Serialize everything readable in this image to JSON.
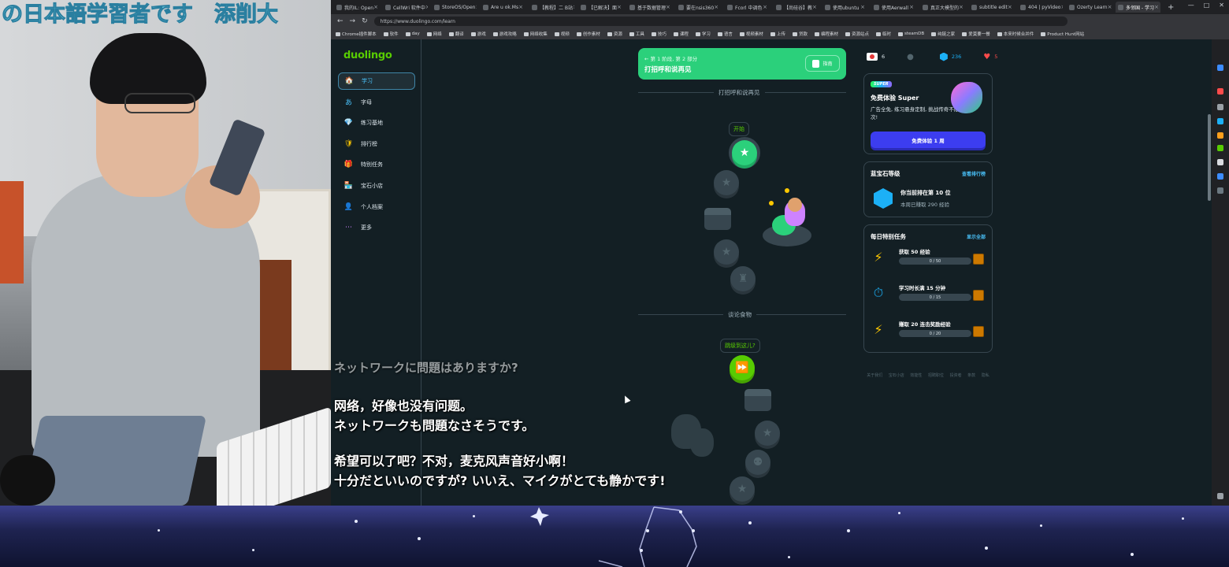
{
  "stream": {
    "banner": "の日本語学習者です　添削大",
    "subtitles": [
      "ネットワークに問題はありますか?",
      "网络，好像也没有问题。",
      "ネットワークも問題なさそうです。",
      "希望可以了吧？不对，麦克风声音好小啊！",
      "十分だといいのですが? いいえ、マイクがとても静かです!"
    ]
  },
  "browser": {
    "tabs": [
      "我的IL: Open",
      "CellWri 软件中",
      "StoreOS/Open",
      "Are u ok.Ms",
      "【教程】二 B站",
      "【已解决】面",
      "基于数据管理",
      "要在nsis360",
      "Fcorl 中调色",
      "【尚硅谷】教",
      "使用ubuntu",
      "使用Aerwall",
      "真正大模型的",
      "subtitle edit",
      "404 | pyVideo",
      "Ozerty Learn",
      "多邻国 - 学习"
    ],
    "window_controls": [
      "—",
      "□",
      "✕"
    ],
    "url": "https://www.duolingo.com/learn",
    "bookmarks": [
      "Chrome插件脚本",
      "软件",
      "day",
      "网络",
      "翻译",
      "游戏",
      "游戏攻略",
      "网络收集",
      "视频",
      "创作素材",
      "资源",
      "工具",
      "技巧",
      "课程",
      "学习",
      "语言",
      "视频素材",
      "上传",
      "贷款",
      "编程素材",
      "资源站点",
      "临时",
      "steamDB",
      "纯链之家",
      "爱莫要一餐",
      "本来时候合并件",
      "Product Hunt网站"
    ]
  },
  "sidebar": {
    "logo": "duolingo",
    "items": [
      {
        "label": "学习",
        "icon": "🏠"
      },
      {
        "label": "字母",
        "icon": "あ"
      },
      {
        "label": "练习基地",
        "icon": "💎"
      },
      {
        "label": "排行榜",
        "icon": "🛡"
      },
      {
        "label": "特别任务",
        "icon": "🎁"
      },
      {
        "label": "宝石小店",
        "icon": "🏪"
      },
      {
        "label": "个人档案",
        "icon": "👤"
      },
      {
        "label": "更多",
        "icon": "⋯"
      }
    ]
  },
  "path": {
    "unit_small": "← 第 1 阶段, 第 2 部分",
    "unit_title": "打招呼和说再见",
    "guide_label": "指南",
    "section1_label": "打招呼和说再见",
    "start_tooltip": "开始",
    "section2_label": "谈论食物",
    "jump_tooltip": "跳级到这儿?"
  },
  "stats": {
    "flag": "🇯🇵",
    "courses": "6",
    "streak": "",
    "gems": "236",
    "hearts": "5"
  },
  "super": {
    "badge": "SUPER",
    "title": "免费体验 Super",
    "desc": "广告全免, 练习悬身定制, 挑战传奇不限次!",
    "button": "免费体验 1 周"
  },
  "leaderboard": {
    "title": "蓝宝石等级",
    "link": "查看排行榜",
    "rank": "你当前排在第 10 位",
    "xp": "本周已赚取 290 经验"
  },
  "quests": {
    "title": "每日特别任务",
    "link": "显示全部",
    "items": [
      {
        "title": "获取 50 经验",
        "progress": "0 / 50",
        "icon": "⚡",
        "color": "#ffc800"
      },
      {
        "title": "学习时长满 15 分钟",
        "progress": "0 / 15",
        "icon": "⏱",
        "color": "#1cb0f6"
      },
      {
        "title": "赚取 20 连击奖励经验",
        "progress": "0 / 20",
        "icon": "⚡",
        "color": "#ffc800"
      }
    ]
  },
  "footer": {
    "links": "关于我们 宝石小店 效能性 招聘职位 投资者 条款 隐私"
  },
  "colors": {
    "accent_green": "#58cc02",
    "banner": "#2bd07b",
    "blue": "#1cb0f6",
    "page_bg": "#131f24"
  }
}
